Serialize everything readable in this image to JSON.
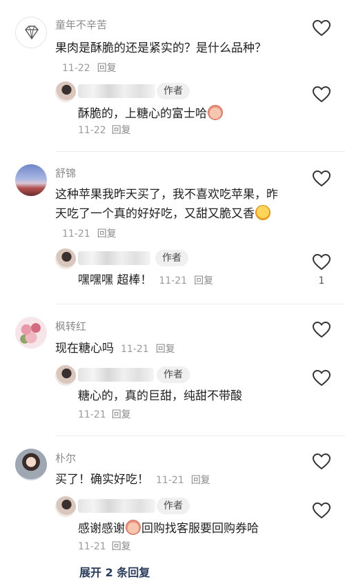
{
  "threads": [
    {
      "user": "童年不辛苦",
      "avatar_icon": "diamond-icon",
      "text": "果肉是酥脆的还是紧实的？是什么品种？",
      "date": "11-22",
      "reply_label": "回复",
      "like_count": "",
      "reply": {
        "author_tag": "作者",
        "text": "酥脆的，上糖心的富士哈",
        "emoji_icon": "peach-emoji-icon",
        "date": "11-22",
        "reply_label": "回复",
        "like_count": ""
      }
    },
    {
      "user": "舒锦",
      "avatar_icon": "landscape-avatar-icon",
      "text": "这种苹果我昨天买了，我不喜欢吃苹果，昨天吃了一个真的好好吃，又甜又脆又香",
      "emoji_icon": "grin-emoji-icon",
      "date": "11-21",
      "reply_label": "回复",
      "like_count": "",
      "reply": {
        "author_tag": "作者",
        "text": "嘿嘿嘿 超棒！",
        "date": "11-21",
        "reply_label": "回复",
        "like_count": "1"
      }
    },
    {
      "user": "枫转红",
      "avatar_icon": "flowers-avatar-icon",
      "text": "现在糖心吗",
      "date": "11-21",
      "reply_label": "回复",
      "like_count": "",
      "reply": {
        "author_tag": "作者",
        "text": "糖心的，真的巨甜，纯甜不带酸",
        "date": "11-21",
        "reply_label": "回复",
        "like_count": ""
      }
    },
    {
      "user": "朴尔",
      "avatar_icon": "portrait-avatar-icon",
      "text": "买了！确实好吃！",
      "date": "11-21",
      "reply_label": "回复",
      "like_count": "",
      "reply": {
        "author_tag": "作者",
        "text_before": "感谢感谢",
        "emoji_icon": "peach-emoji-icon",
        "text_after": "回购找客服要回购券哈",
        "date": "11-21",
        "reply_label": "回复",
        "like_count": ""
      }
    }
  ],
  "more_replies_label": "展开 2 条回复",
  "colors": {
    "divider": "#ededed",
    "link": "#2a3b5c",
    "muted": "#9a9a9a"
  }
}
